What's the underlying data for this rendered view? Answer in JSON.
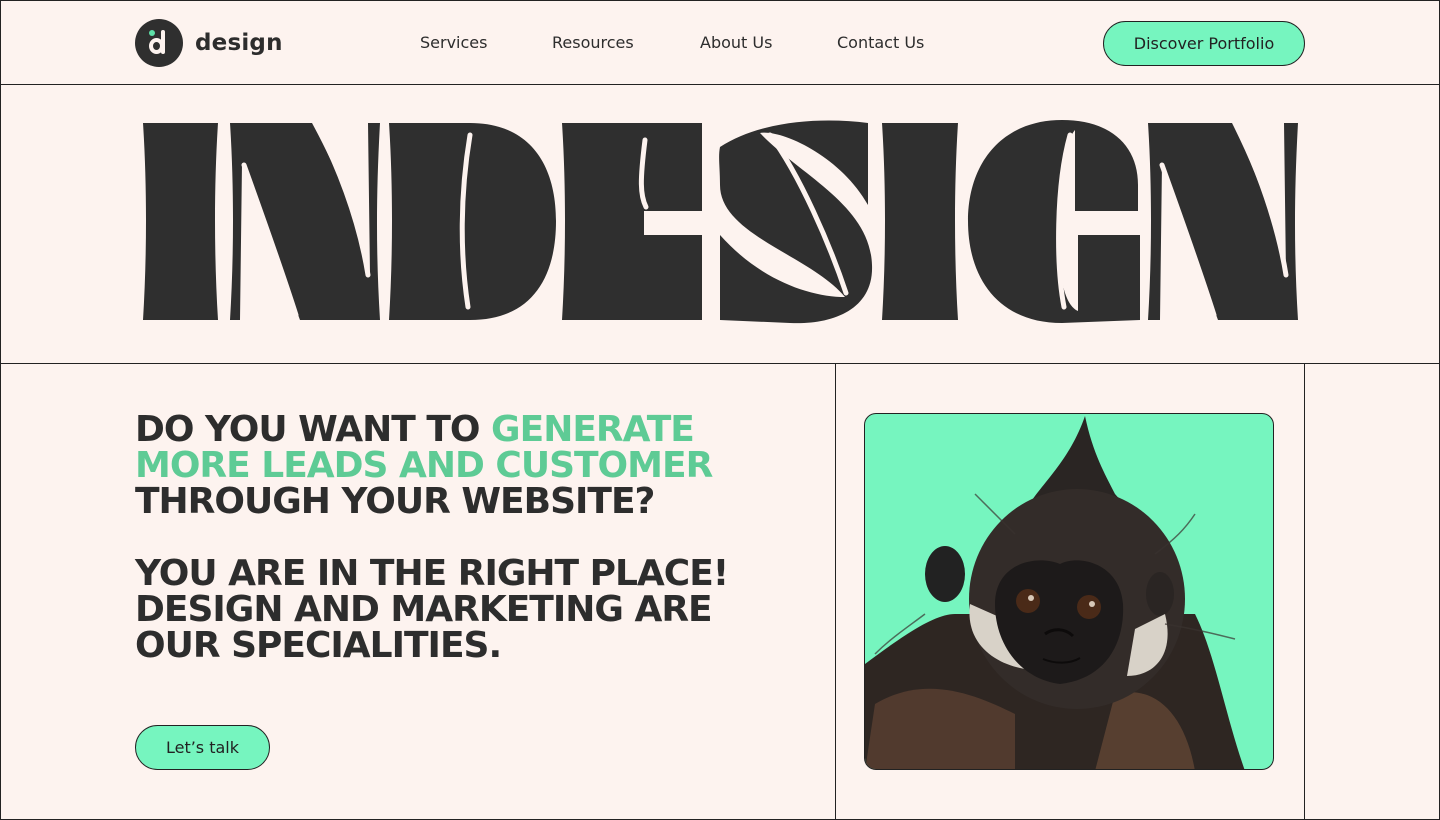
{
  "header": {
    "logo_text": "design",
    "nav": [
      "Services",
      "Resources",
      "About Us",
      "Contact Us"
    ],
    "cta_label": "Discover Portfolio"
  },
  "hero": {
    "wordmark": "INDESIGN"
  },
  "main": {
    "headline_part1": "DO YOU WANT TO ",
    "headline_accent": "GENERATE MORE LEADS AND CUSTOMER",
    "headline_part2": " THROUGH YOUR WEBSITE?",
    "subheadline": "YOU ARE IN THE RIGHT PLACE! DESIGN AND MARKETING ARE OUR SPECIALITIES.",
    "cta_label": "Let’s talk"
  },
  "colors": {
    "background": "#fdf3ef",
    "accent": "#76f5bf",
    "accent_text": "#5ecb95",
    "ink": "#2d2d2d"
  },
  "icons": {
    "logo": "d-logo-icon"
  }
}
